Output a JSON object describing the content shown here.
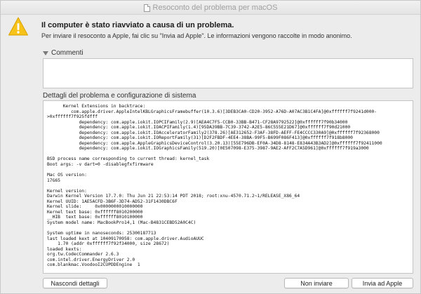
{
  "window": {
    "title": "Resoconto del problema per macOS"
  },
  "header": {
    "icon": "warning-icon",
    "headline": "Il computer è stato riavviato a causa di un problema.",
    "subline": "Per inviare il resoconto a Apple, fai clic su \"Invia ad Apple\". Le informazioni vengono raccolte in modo anonimo."
  },
  "comments": {
    "label": "Commenti",
    "value": ""
  },
  "details": {
    "label": "Dettagli del problema e configurazione di sistema",
    "lines": [
      "      Kernel Extensions in backtrace:",
      "         com.apple.driver.AppleIntelKBLGraphicsFramebuffer(10.3.6)[3DEB3CA0-CD20-3952-A76D-A07AC3B1C4FA]@0xffffff7f9241d000-",
      ">0xffffff7f925fdfff",
      "            dependency: com.apple.iokit.IOPCIFamily(2.9)[AEA4C7F5-CCB0-33BB-B471-CF28A9792522]@0xffffff7f90b34000",
      "            dependency: com.apple.iokit.IOACPIFamily(1.4)[95DA39BB-7C39-3742-A2E5-86C555E21D67]@0xffffff7f90d21000",
      "            dependency: com.apple.iokit.IOAcceleratorFamily2(378.26)[AE312652-F3AF-38FD-AEFF-FE4CCCC330A9]@0xffffff7f92368000",
      "            dependency: com.apple.iokit.IOReportFamily(31)[D2F2FBDF-4EE4-38BA-99F5-B699F086F413]@0xffffff7f918b8000",
      "            dependency: com.apple.AppleGraphicsDeviceControl(3.20.13)[55E796DB-EF0A-34D8-8148-E834A43B3AD2]@0xffffff7f92411000",
      "            dependency: com.apple.iokit.IOGraphicsFamily(519.20)[0E507098-E375-3987-9AE2-AFF2C7A5D961]@0xffffff7f919a3000",
      "",
      "BSD process name corresponding to current thread: kernel_task",
      "Boot args: -v dart=0 -disablegfxfirmware",
      "",
      "Mac OS version:",
      "17G65",
      "",
      "Kernel version:",
      "Darwin Kernel Version 17.7.0: Thu Jun 21 22:53:14 PDT 2018; root:xnu-4570.71.2~1/RELEASE_X86_64",
      "Kernel UUID: 1AE5ACFD-3B6F-3D74-AD52-31F1430DBC6F",
      "Kernel slide:     0x0000000010000000",
      "Kernel text base: 0xffffff8010200000",
      "__HIB  text base: 0xffffff8010100000",
      "System model name: MacBookPro14,1 (Mac-B4831CEBD52A0C4C)",
      "",
      "System uptime in nanoseconds: 25300187713",
      "last loaded kext at 10409170958: com.apple.driver.AudioAUUC",
      "    1.70 (addr 0xffffff7f92f34000, size 28672)",
      "loaded kexts:",
      "org.tw.CodecCommander 2.6.3",
      "com.intel.driver.EnergyDriver 2.0",
      "com.blankmac.VoodooI2CUPDDEngine  1"
    ]
  },
  "buttons": {
    "hide_details": "Nascondi dettagli",
    "dont_send": "Non inviare",
    "send": "Invia ad Apple"
  }
}
